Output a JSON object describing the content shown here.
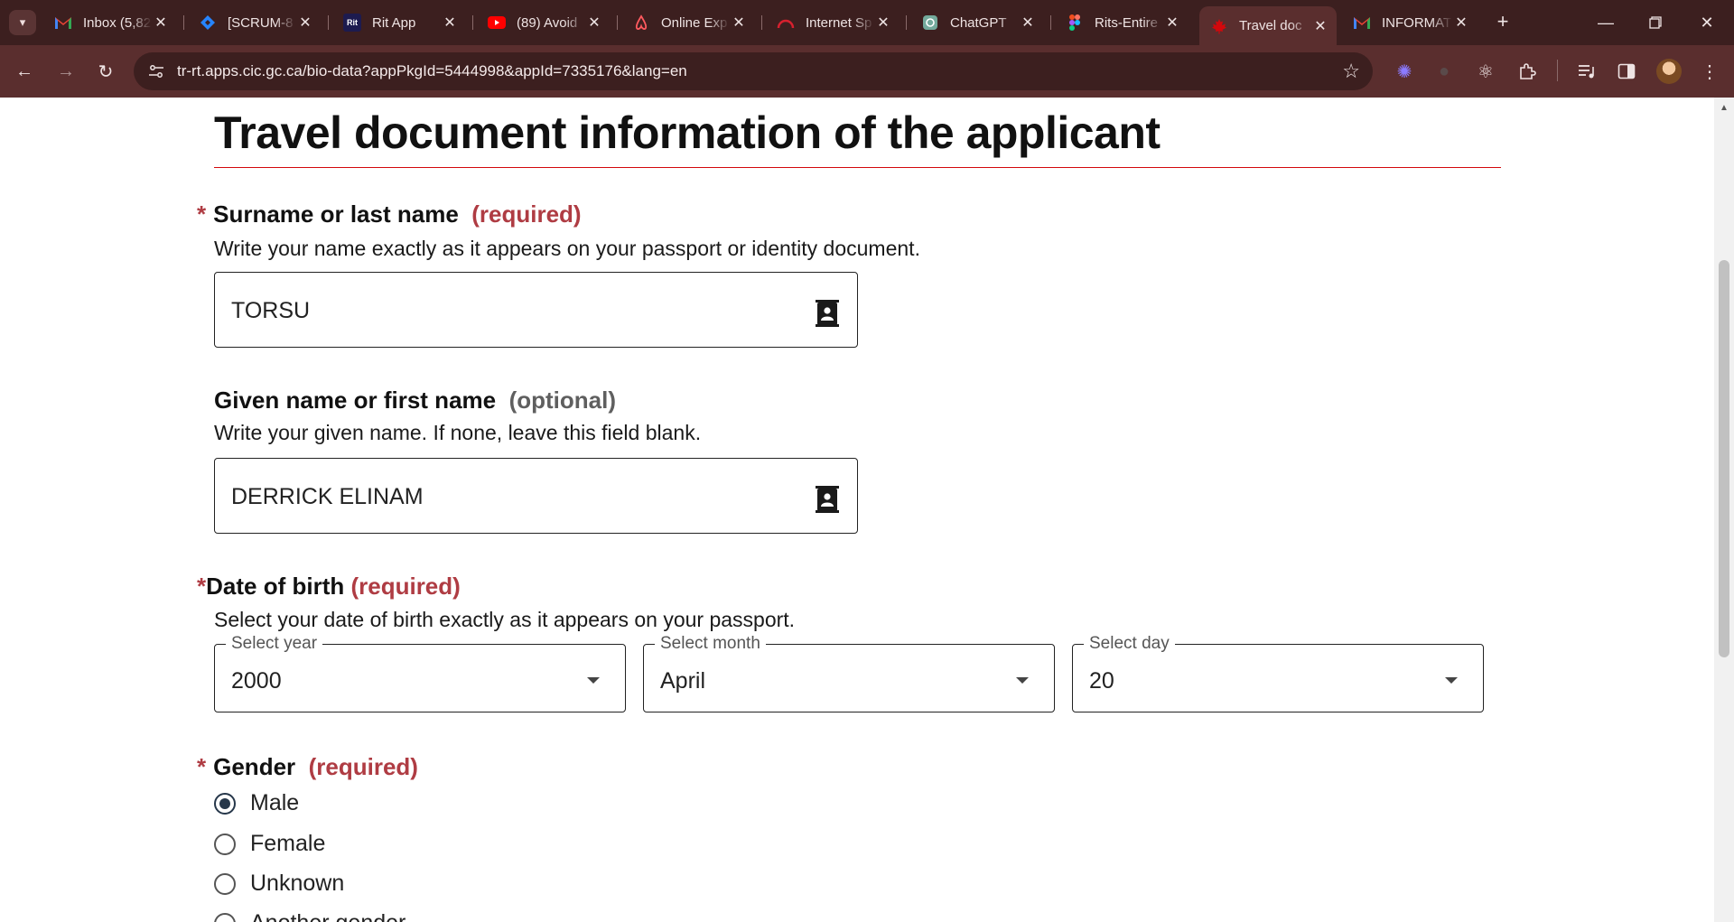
{
  "browser": {
    "tabs": [
      {
        "title": "Inbox (5,82",
        "icon": "gmail-icon",
        "color": "#ea4335"
      },
      {
        "title": "[SCRUM-8",
        "icon": "jira-icon",
        "color": "#2684ff"
      },
      {
        "title": "Rit App",
        "icon": "rit-app-icon",
        "color": "#1d1b4f",
        "icon_text": "Rit"
      },
      {
        "title": "(89) Avoid",
        "icon": "youtube-icon",
        "color": "#ff0000"
      },
      {
        "title": "Online Exp",
        "icon": "airbnb-icon",
        "color": "#ff5a5f"
      },
      {
        "title": "Internet Sp",
        "icon": "speedtest-icon",
        "color": "#d6202e"
      },
      {
        "title": "ChatGPT",
        "icon": "chatgpt-icon",
        "color": "#74aa9c"
      },
      {
        "title": "Rits-Entire",
        "icon": "figma-icon",
        "color": "#a259ff"
      },
      {
        "title": "Travel doc",
        "icon": "maple-leaf-icon",
        "color": "#d3080c",
        "active": true
      },
      {
        "title": "INFORMAT",
        "icon": "gmail-icon",
        "color": "#ea4335"
      }
    ],
    "url": "tr-rt.apps.cic.gc.ca/bio-data?appPkgId=5444998&appId=7335176&lang=en"
  },
  "page": {
    "heading": "Travel document information of the applicant",
    "surname": {
      "label": "Surname or last name",
      "tag": "(required)",
      "help": "Write your name exactly as it appears on your passport or identity document.",
      "value": "TORSU"
    },
    "given_name": {
      "label": "Given name or first name",
      "tag": "(optional)",
      "help": "Write your given name. If none, leave this field blank.",
      "value": "DERRICK ELINAM"
    },
    "dob": {
      "label": "Date of birth",
      "tag": "(required)",
      "help": "Select your date of birth exactly as it appears on your passport.",
      "year": {
        "legend": "Select year",
        "value": "2000"
      },
      "month": {
        "legend": "Select month",
        "value": "April"
      },
      "day": {
        "legend": "Select day",
        "value": "20"
      }
    },
    "gender": {
      "label": "Gender",
      "tag": "(required)",
      "options": [
        "Male",
        "Female",
        "Unknown",
        "Another gender"
      ],
      "selected": "Male"
    }
  },
  "colors": {
    "required": "#af3c43",
    "rule": "#d3080c",
    "chrome": "#5a2e2e"
  }
}
